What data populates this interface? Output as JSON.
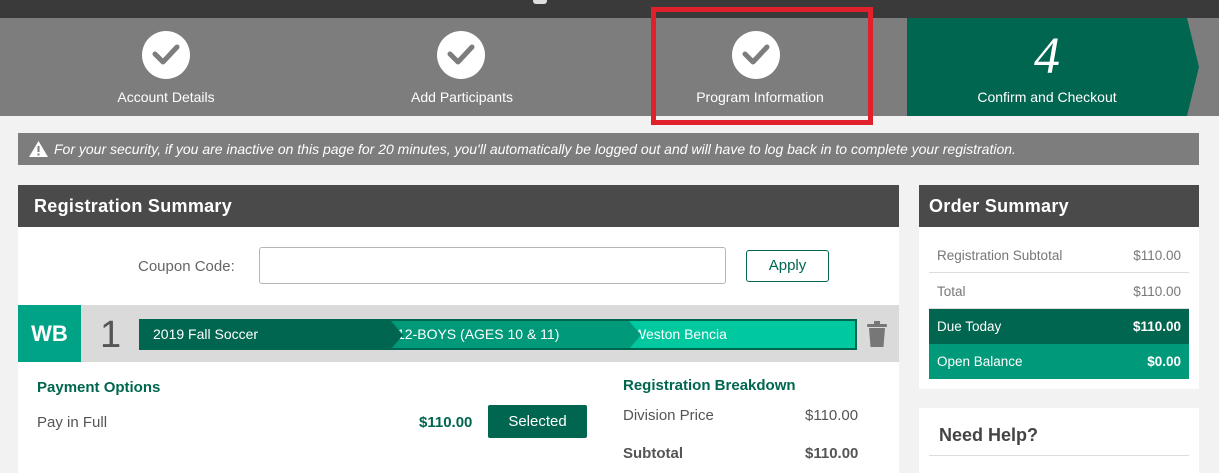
{
  "steps": [
    {
      "label": "Account Details",
      "state": "complete"
    },
    {
      "label": "Add Participants",
      "state": "complete"
    },
    {
      "label": "Program Information",
      "state": "complete"
    },
    {
      "label": "Confirm and Checkout",
      "number": "4",
      "state": "current"
    }
  ],
  "security_notice": "For your security, if you are inactive on this page for 20 minutes, you'll automatically be logged out and will have to log back in to complete your registration.",
  "registration": {
    "title": "Registration Summary",
    "coupon_label": "Coupon Code:",
    "coupon_value": "",
    "apply_label": "Apply",
    "participant": {
      "initials": "WB",
      "number": "1",
      "program": "2019 Fall Soccer",
      "division": "12-BOYS (AGES 10 & 11)",
      "name": "Weston Bencia"
    },
    "payment": {
      "title": "Payment Options",
      "option": "Pay in Full",
      "amount": "$110.00",
      "button": "Selected"
    },
    "breakdown": {
      "title": "Registration Breakdown",
      "rows": [
        {
          "label": "Division Price",
          "value": "$110.00"
        },
        {
          "label": "Subtotal",
          "value": "$110.00"
        }
      ]
    }
  },
  "order": {
    "title": "Order Summary",
    "rows": [
      {
        "label": "Registration Subtotal",
        "value": "$110.00"
      },
      {
        "label": "Total",
        "value": "$110.00"
      },
      {
        "label": "Due Today",
        "value": "$110.00"
      },
      {
        "label": "Open Balance",
        "value": "$0.00"
      }
    ]
  },
  "help": {
    "title": "Need Help?"
  },
  "colors": {
    "brand_green": "#00664f",
    "accent_teal": "#00a385",
    "highlight_red": "#e0202a",
    "step_gray": "#7d7d7d"
  }
}
